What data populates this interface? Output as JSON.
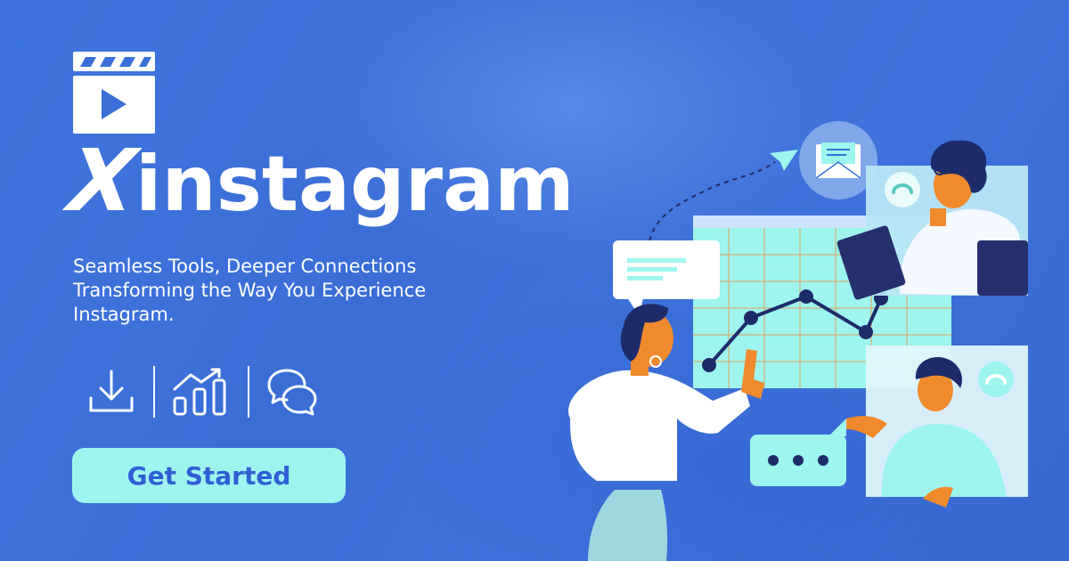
{
  "brand": {
    "prefix": "X",
    "name": "instagram"
  },
  "tagline": {
    "line1": "Seamless Tools, Deeper Connections",
    "line2": "Transforming the Way You Experience",
    "line3": "Instagram."
  },
  "features": [
    {
      "icon": "download-icon"
    },
    {
      "icon": "bar-chart-icon"
    },
    {
      "icon": "chat-bubbles-icon"
    }
  ],
  "cta": {
    "label": "Get Started"
  },
  "colors": {
    "background": "#3a6fd8",
    "button": "#9ff3ef",
    "button_text": "#2f5fd4",
    "text": "#ffffff",
    "accent_navy": "#26306e",
    "accent_teal": "#9df5ee",
    "skin": "#f08a2c"
  }
}
